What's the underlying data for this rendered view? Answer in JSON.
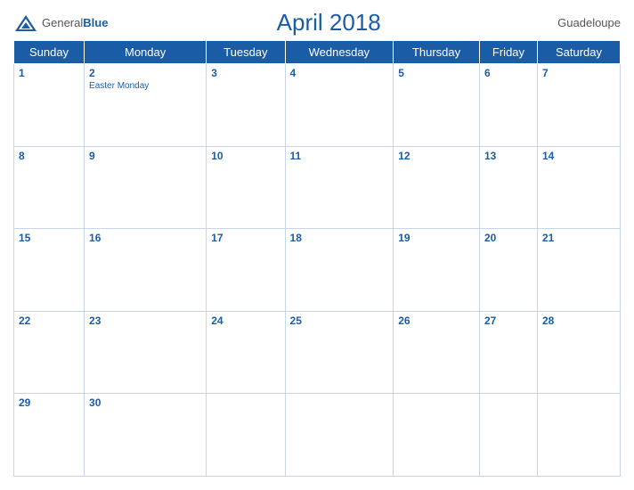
{
  "header": {
    "logo_general": "General",
    "logo_blue": "Blue",
    "title": "April 2018",
    "region": "Guadeloupe"
  },
  "weekdays": [
    "Sunday",
    "Monday",
    "Tuesday",
    "Wednesday",
    "Thursday",
    "Friday",
    "Saturday"
  ],
  "weeks": [
    [
      {
        "day": "1",
        "holiday": ""
      },
      {
        "day": "2",
        "holiday": "Easter Monday"
      },
      {
        "day": "3",
        "holiday": ""
      },
      {
        "day": "4",
        "holiday": ""
      },
      {
        "day": "5",
        "holiday": ""
      },
      {
        "day": "6",
        "holiday": ""
      },
      {
        "day": "7",
        "holiday": ""
      }
    ],
    [
      {
        "day": "8",
        "holiday": ""
      },
      {
        "day": "9",
        "holiday": ""
      },
      {
        "day": "10",
        "holiday": ""
      },
      {
        "day": "11",
        "holiday": ""
      },
      {
        "day": "12",
        "holiday": ""
      },
      {
        "day": "13",
        "holiday": ""
      },
      {
        "day": "14",
        "holiday": ""
      }
    ],
    [
      {
        "day": "15",
        "holiday": ""
      },
      {
        "day": "16",
        "holiday": ""
      },
      {
        "day": "17",
        "holiday": ""
      },
      {
        "day": "18",
        "holiday": ""
      },
      {
        "day": "19",
        "holiday": ""
      },
      {
        "day": "20",
        "holiday": ""
      },
      {
        "day": "21",
        "holiday": ""
      }
    ],
    [
      {
        "day": "22",
        "holiday": ""
      },
      {
        "day": "23",
        "holiday": ""
      },
      {
        "day": "24",
        "holiday": ""
      },
      {
        "day": "25",
        "holiday": ""
      },
      {
        "day": "26",
        "holiday": ""
      },
      {
        "day": "27",
        "holiday": ""
      },
      {
        "day": "28",
        "holiday": ""
      }
    ],
    [
      {
        "day": "29",
        "holiday": ""
      },
      {
        "day": "30",
        "holiday": ""
      },
      {
        "day": "",
        "holiday": ""
      },
      {
        "day": "",
        "holiday": ""
      },
      {
        "day": "",
        "holiday": ""
      },
      {
        "day": "",
        "holiday": ""
      },
      {
        "day": "",
        "holiday": ""
      }
    ]
  ]
}
